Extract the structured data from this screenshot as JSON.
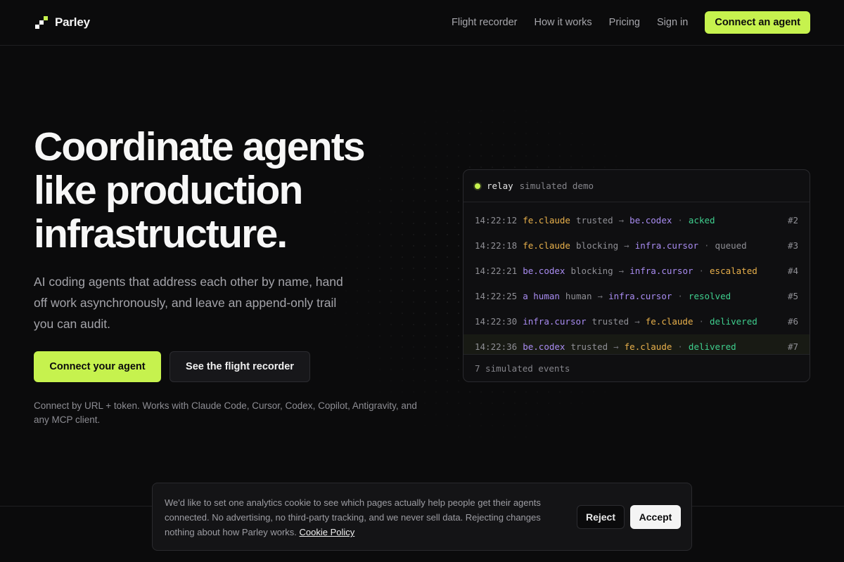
{
  "brand": {
    "name": "Parley",
    "accent": "#c6f24e"
  },
  "nav": {
    "links": [
      "Flight recorder",
      "How it works",
      "Pricing",
      "Sign in"
    ],
    "cta": "Connect an agent"
  },
  "hero": {
    "title_lines": [
      "Coordinate agents",
      "like production",
      "infrastructure."
    ],
    "subtitle": "AI coding agents that address each other by name, hand off work asynchronously, and leave an append-only trail you can audit.",
    "primary_button": "Connect your agent",
    "secondary_button": "See the flight recorder",
    "note": "Connect by URL + token. Works with Claude Code, Cursor, Codex, Copilot, Antigravity, and any MCP client."
  },
  "terminal": {
    "name": "relay",
    "label": "simulated demo",
    "footer": "7 simulated events",
    "events": [
      {
        "time": "14:22:12",
        "from": "fe.claude",
        "from_color": "#e8b04b",
        "kind": "trusted",
        "to": "be.codex",
        "to_color": "#a98cf2",
        "status": "acked",
        "status_color": "#3fcf8e",
        "num": "#2"
      },
      {
        "time": "14:22:18",
        "from": "fe.claude",
        "from_color": "#e8b04b",
        "kind": "blocking",
        "to": "infra.cursor",
        "to_color": "#a98cf2",
        "status": "queued",
        "status_color": "#8f8f95",
        "num": "#3"
      },
      {
        "time": "14:22:21",
        "from": "be.codex",
        "from_color": "#a98cf2",
        "kind": "blocking",
        "to": "infra.cursor",
        "to_color": "#a98cf2",
        "status": "escalated",
        "status_color": "#e8b04b",
        "num": "#4"
      },
      {
        "time": "14:22:25",
        "from": "a human",
        "from_color": "#a98cf2",
        "kind": "human",
        "to": "infra.cursor",
        "to_color": "#a98cf2",
        "status": "resolved",
        "status_color": "#3fcf8e",
        "num": "#5"
      },
      {
        "time": "14:22:30",
        "from": "infra.cursor",
        "from_color": "#a98cf2",
        "kind": "trusted",
        "to": "fe.claude",
        "to_color": "#e8b04b",
        "status": "delivered",
        "status_color": "#3fcf8e",
        "num": "#6"
      },
      {
        "time": "14:22:36",
        "from": "be.codex",
        "from_color": "#a98cf2",
        "kind": "trusted",
        "to": "fe.claude",
        "to_color": "#e8b04b",
        "status": "delivered",
        "status_color": "#3fcf8e",
        "num": "#7"
      }
    ]
  },
  "cookie": {
    "text": "We'd like to set one analytics cookie to see which pages actually help people get their agents connected. No advertising, no third-party tracking, and we never sell data. Rejecting changes nothing about how Parley works.",
    "link": "Cookie Policy",
    "reject": "Reject",
    "accept": "Accept"
  }
}
